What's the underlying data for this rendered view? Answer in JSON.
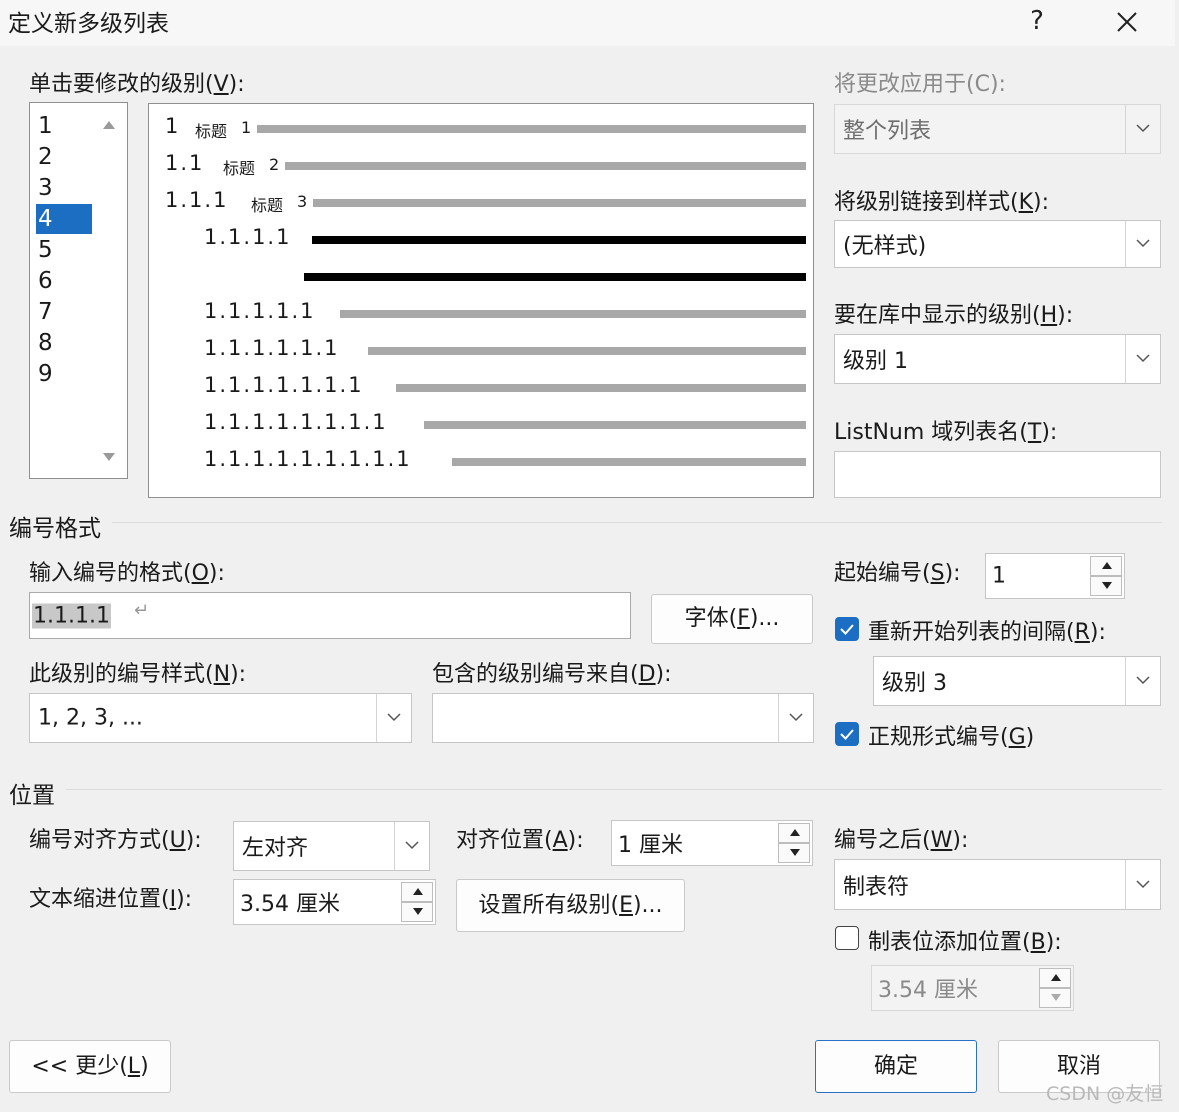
{
  "window": {
    "title": "定义新多级列表",
    "help": "?",
    "close": "✕"
  },
  "levels": {
    "label": "单击要修改的级别(V):",
    "items": [
      "1",
      "2",
      "3",
      "4",
      "5",
      "6",
      "7",
      "8",
      "9"
    ],
    "selected": "4"
  },
  "preview": {
    "rows": [
      {
        "num": "1",
        "style": "标题",
        "level": "1"
      },
      {
        "num": "1.1",
        "style": "标题",
        "level": "2"
      },
      {
        "num": "1.1.1",
        "style": "标题",
        "level": "3"
      },
      {
        "num": "1.1.1.1"
      },
      {
        "num": "1.1.1.1.1"
      },
      {
        "num": "1.1.1.1.1.1"
      },
      {
        "num": "1.1.1.1.1.1.1"
      },
      {
        "num": "1.1.1.1.1.1.1.1"
      },
      {
        "num": "1.1.1.1.1.1.1.1.1"
      }
    ]
  },
  "right": {
    "apply_to_label": "将更改应用于(C):",
    "apply_to_value": "整个列表",
    "link_style_label": "将级别链接到样式(K):",
    "link_style_value": "(无样式)",
    "gallery_level_label": "要在库中显示的级别(H):",
    "gallery_level_value": "级别 1",
    "listnum_label": "ListNum 域列表名(T):",
    "listnum_value": ""
  },
  "numbering": {
    "section": "编号格式",
    "format_label": "输入编号的格式(O):",
    "format_value": "1.1.1.1",
    "font_button": "字体(F)...",
    "style_label": "此级别的编号样式(N):",
    "style_value": "1, 2, 3, ...",
    "include_label": "包含的级别编号来自(D):",
    "include_value": "",
    "start_label": "起始编号(S):",
    "start_value": "1",
    "restart_label": "重新开始列表的间隔(R):",
    "restart_checked": true,
    "restart_value": "级别 3",
    "legal_label": "正规形式编号(G)",
    "legal_checked": true
  },
  "position": {
    "section": "位置",
    "align_label": "编号对齐方式(U):",
    "align_value": "左对齐",
    "align_at_label": "对齐位置(A):",
    "align_at_value": "1 厘米",
    "indent_label": "文本缩进位置(I):",
    "indent_value": "3.54 厘米",
    "set_all_button": "设置所有级别(E)...",
    "follow_label": "编号之后(W):",
    "follow_value": "制表符",
    "tab_add_label": "制表位添加位置(B):",
    "tab_add_checked": false,
    "tab_add_value": "3.54 厘米"
  },
  "footer": {
    "less_button": "<< 更少(L)",
    "ok_button": "确定",
    "cancel_button": "取消",
    "watermark": "CSDN @友恒"
  },
  "colors": {
    "accent": "#1b6ec2",
    "preview_bar": "#a8a8a8"
  }
}
